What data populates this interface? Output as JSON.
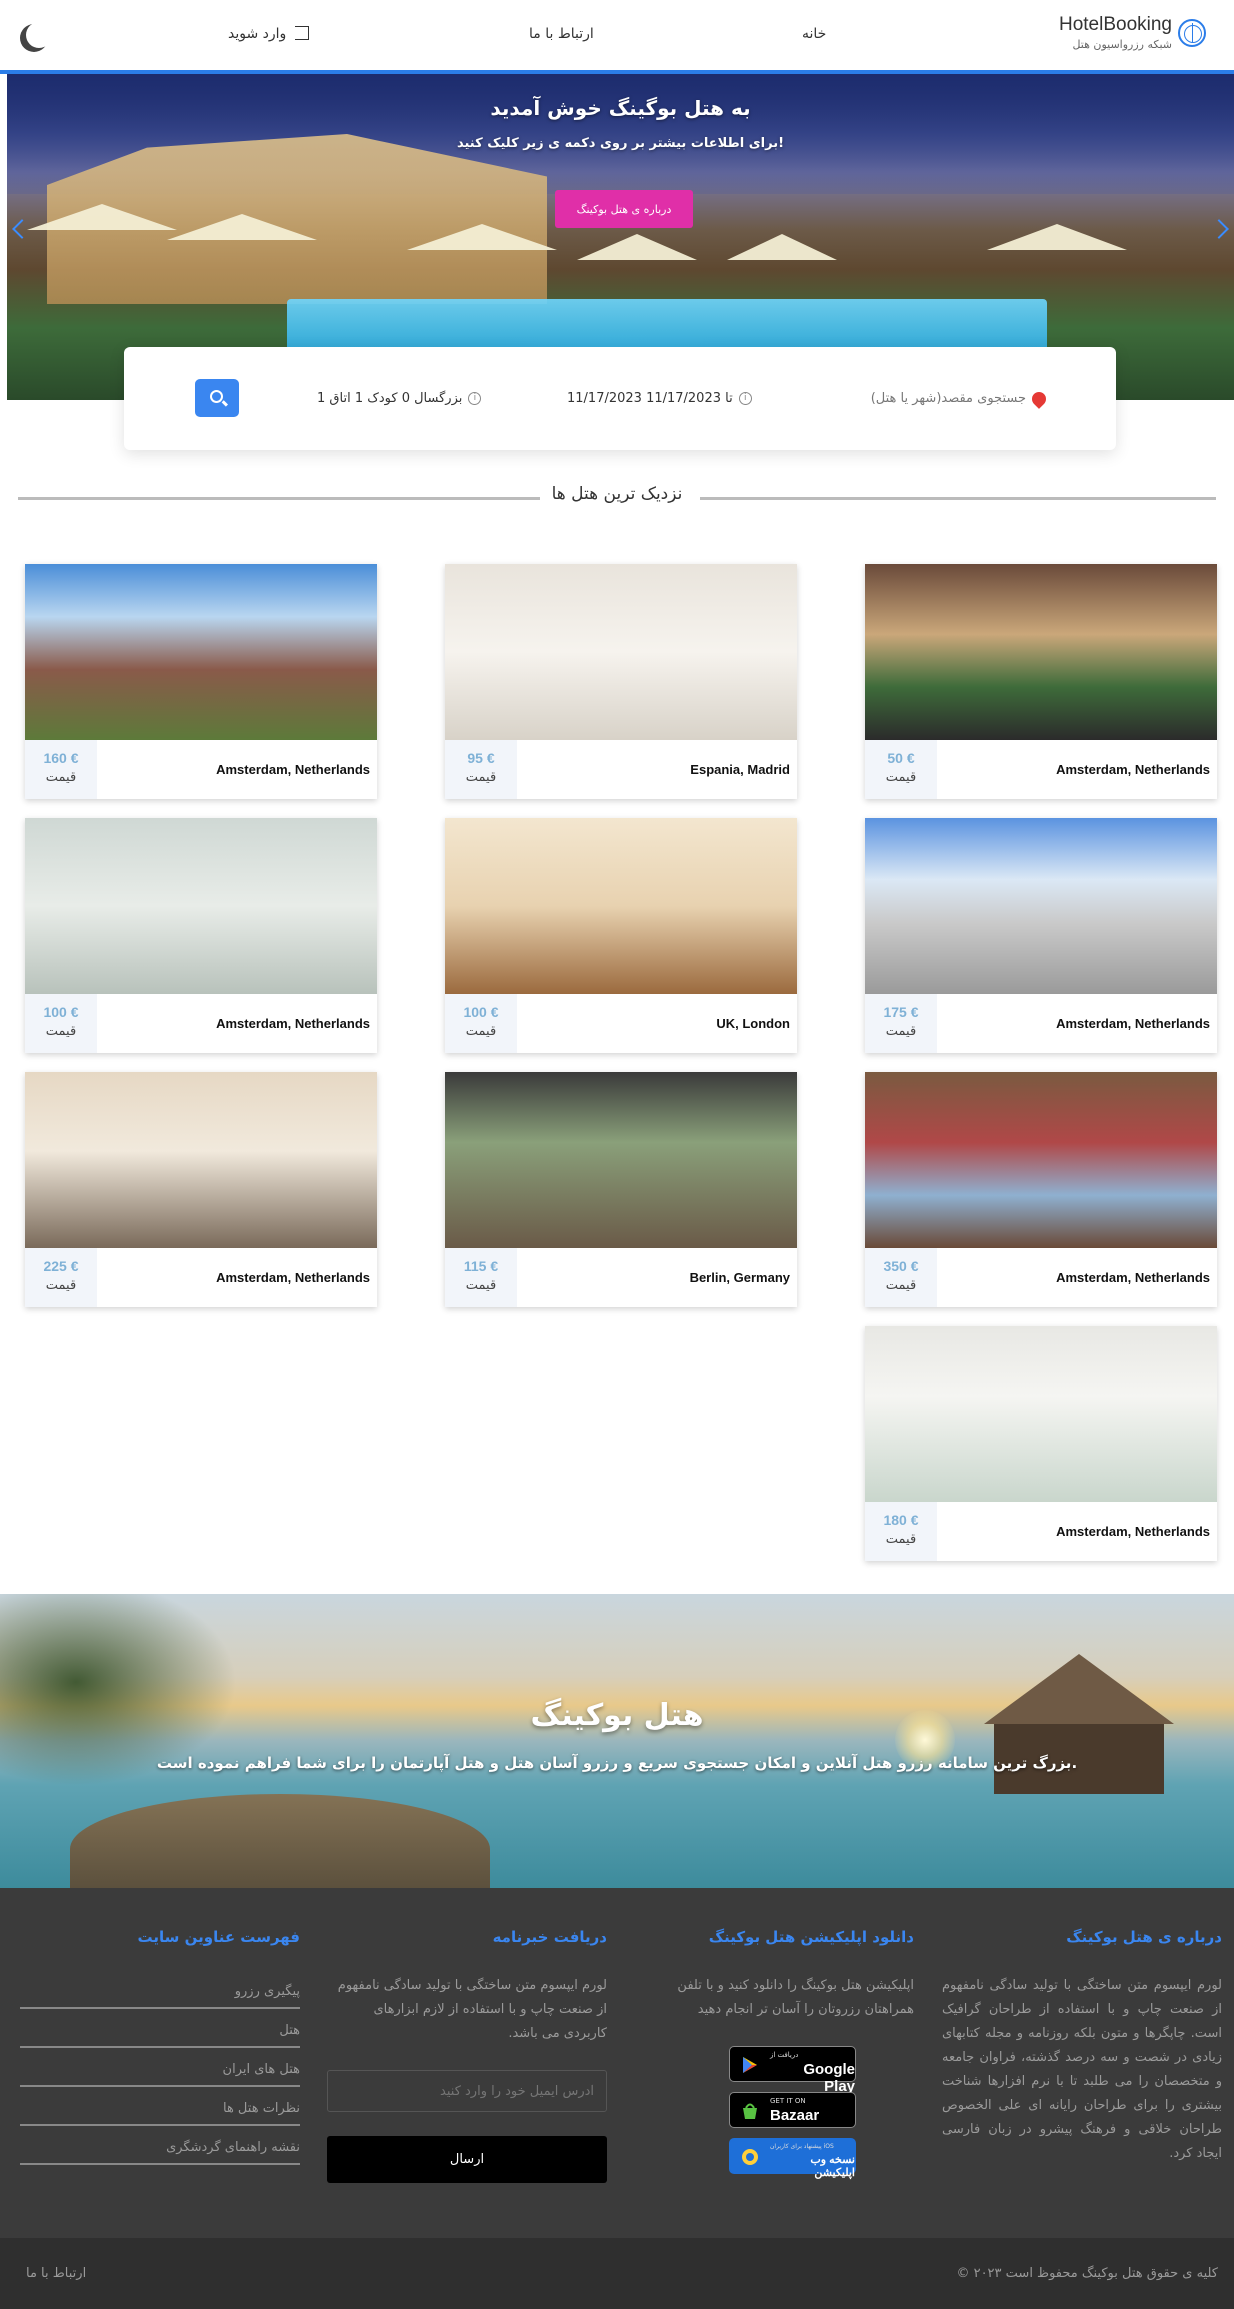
{
  "header": {
    "logo_title": "HotelBooking",
    "logo_subtitle": "شبکه رزرواسیون هتل",
    "nav_home": "خانه",
    "nav_contact": "ارتباط با ما",
    "nav_login": "وارد شوید"
  },
  "hero": {
    "title": "به هتل بوگینگ خوش آمدید",
    "subtitle": "برای اطلاعات بیشتر بر روی دکمه ی زیر کلیک کنید!",
    "button": "درباره ی هتل بوکینگ"
  },
  "search": {
    "destination_placeholder": "جستجوی مقصد(شهر یا هتل)",
    "dates": "11/17/2023 تا 11/17/2023",
    "guests": "1 بزرگسال 0 کودک 1 اتاق"
  },
  "section_title": "نزدیک ترین هتل ها",
  "price_label": "قیمت",
  "hotels": [
    {
      "city": "Amsterdam, Netherlands",
      "price": "50 €"
    },
    {
      "city": "Espania, Madrid",
      "price": "95 €"
    },
    {
      "city": "Amsterdam, Netherlands",
      "price": "160 €"
    },
    {
      "city": "Amsterdam, Netherlands",
      "price": "175 €"
    },
    {
      "city": "UK, London",
      "price": "100 €"
    },
    {
      "city": "Amsterdam, Netherlands",
      "price": "100 €"
    },
    {
      "city": "Amsterdam, Netherlands",
      "price": "350 €"
    },
    {
      "city": "Berlin, Germany",
      "price": "115 €"
    },
    {
      "city": "Amsterdam, Netherlands",
      "price": "225 €"
    },
    {
      "city": "Amsterdam, Netherlands",
      "price": "180 €"
    }
  ],
  "banner": {
    "title": "هتل بوکینگ",
    "subtitle": "بزرگ ترین سامانه رزرو هتل آنلاین و امکان جستجوی سریع و رزرو آسان هتل و هتل آپارتمان را برای شما فراهم نموده است."
  },
  "footer": {
    "about_title": "درباره ی هتل بوکینگ",
    "about_text": "لورم ایپسوم متن ساختگی با تولید سادگی نامفهوم از صنعت چاپ و با استفاده از طراحان گرافیک است. چاپگرها و متون بلکه روزنامه و مجله کتابهای زیادی در شصت و سه درصد گذشته، فراوان جامعه و متخصصان را می طلبد تا با نرم افزارها شناخت بیشتری را برای طراحان رایانه ای علی الخصوص طراحان خلاقی و فرهنگ پیشرو در زبان فارسی ایجاد کرد.",
    "app_title": "دانلود اپلیکیشن هتل بوکینگ",
    "app_text": "اپلیکیشن هتل بوکینگ را دانلود کنید و با تلفن همراهتان رزروتان را آسان تر انجام دهید",
    "google_small": "دریافت از",
    "google_big": "Google Play",
    "bazaar_small": "GET IT ON",
    "bazaar_big": "Bazaar",
    "web_small": "پیشنهاد برای کاربران iOS",
    "web_big": "نسخه وب اپلیکیشن",
    "newsletter_title": "دریافت خبرنامه",
    "newsletter_text": "لورم ایپسوم متن ساختگی با تولید سادگی نامفهوم از صنعت چاپ و با استفاده از لازم ابزارهای کاربردی می باشد.",
    "email_placeholder": "آدرس ایمیل خود را وارد کنید",
    "send": "ارسال",
    "links_title": "فهرست عناوین سایت",
    "links": [
      "پیگیری رزرو",
      "هتل",
      "هتل های ایران",
      "نظرات هتل ها",
      "نقشه راهنمای گردشگری"
    ],
    "copyright": "© ۲۰۲۳ کلیه ی حقوق هتل بوکینگ محفوظ است",
    "contact": "ارتباط با ما"
  },
  "colors": {
    "accent": "#2b7de9",
    "hero_button": "#e02fa8",
    "price": "#7fb1d6",
    "footer_bg": "#3b3b3b"
  }
}
